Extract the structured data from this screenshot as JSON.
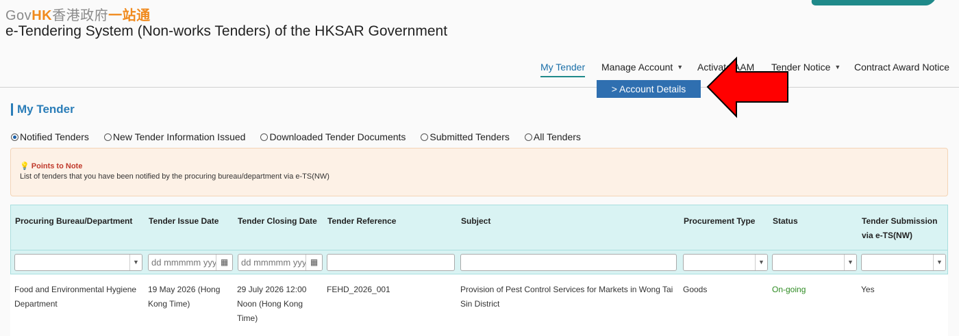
{
  "header": {
    "logo": {
      "gov": "Gov",
      "hk": "HK",
      "chinese_1": "香港政府",
      "chinese_2": "一站通"
    },
    "system_title": "e-Tendering System (Non-works Tenders) of the HKSAR Government"
  },
  "nav": {
    "items": [
      {
        "label": "My Tender",
        "active": true
      },
      {
        "label": "Manage Account",
        "dropdown": true
      },
      {
        "label": "Activate AAM"
      },
      {
        "label": "Tender Notice",
        "dropdown": true
      },
      {
        "label": "Contract Award Notice"
      }
    ],
    "dropdown_item": "> Account Details",
    "arrow_color": "#ff0000"
  },
  "page": {
    "title": "My Tender",
    "filters": [
      {
        "label": "Notified Tenders",
        "selected": true
      },
      {
        "label": "New Tender Information Issued",
        "selected": false
      },
      {
        "label": "Downloaded Tender Documents",
        "selected": false
      },
      {
        "label": "Submitted Tenders",
        "selected": false
      },
      {
        "label": "All Tenders",
        "selected": false
      }
    ],
    "note": {
      "icon": "lightbulb-icon",
      "title": "Points to Note",
      "body": "List of tenders that you have been notified by the procuring bureau/department via e-TS(NW)"
    }
  },
  "table": {
    "columns": [
      "Procuring Bureau/Department",
      "Tender Issue Date",
      "Tender Closing Date",
      "Tender Reference",
      "Subject",
      "Procurement Type",
      "Status",
      "Tender Submission via e-TS(NW)"
    ],
    "date_placeholder": "dd mmmmm yyyy",
    "rows": [
      {
        "department": "Food and Environmental Hygiene Department",
        "issue_date": "19 May 2026 (Hong Kong Time)",
        "closing_date": "29 July 2026 12:00 Noon (Hong Kong Time)",
        "reference": "FEHD_2026_001",
        "subject": "Provision of Pest Control Services for Markets in Wong Tai Sin District",
        "procurement_type": "Goods",
        "status": "On-going",
        "submission": "Yes"
      }
    ]
  },
  "colors": {
    "accent": "#1f8a8a",
    "header_bg": "#d9f3f3",
    "dropdown_bg": "#2f6fb0",
    "status_ongoing": "#2e8b22"
  }
}
